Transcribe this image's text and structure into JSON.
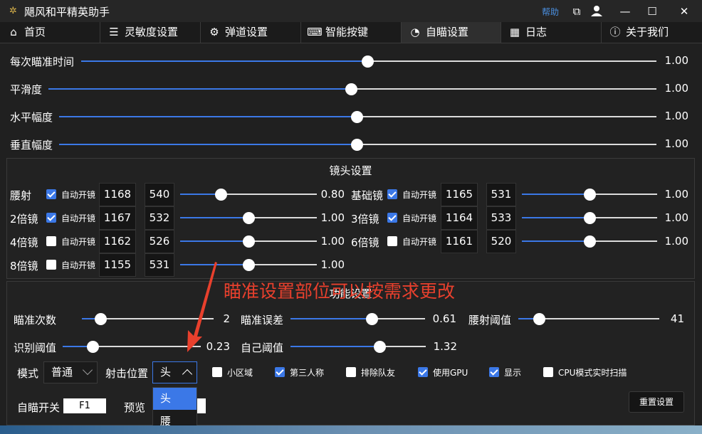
{
  "window": {
    "title": "飓风和平精英助手",
    "help_label": "帮助",
    "controls": [
      "pin-icon",
      "user-icon",
      "minimize-icon",
      "maximize-icon",
      "close-icon"
    ]
  },
  "tabs": [
    {
      "label": "首页",
      "icon": "home-icon"
    },
    {
      "label": "灵敏度设置",
      "icon": "sliders-icon"
    },
    {
      "label": "弹道设置",
      "icon": "gears-icon"
    },
    {
      "label": "智能按键",
      "icon": "keyboard-icon"
    },
    {
      "label": "自瞄设置",
      "icon": "ai-icon",
      "active": true
    },
    {
      "label": "日志",
      "icon": "calendar-icon"
    },
    {
      "label": "关于我们",
      "icon": "info-icon"
    }
  ],
  "top_sliders": [
    {
      "label": "每次瞄准时间",
      "value": "1.00",
      "position": 0.5
    },
    {
      "label": "平滑度",
      "value": "1.00",
      "position": 0.5
    },
    {
      "label": "水平幅度",
      "value": "1.00",
      "position": 0.5
    },
    {
      "label": "垂直幅度",
      "value": "1.00",
      "position": 0.5
    }
  ],
  "lens": {
    "title": "镜头设置",
    "auto_label": "自动开镜",
    "rows": [
      {
        "name": "腰射",
        "checked": true,
        "a": "1168",
        "b": "540",
        "value": "0.80",
        "position": 0.4
      },
      {
        "name": "基础镜",
        "checked": true,
        "a": "1165",
        "b": "531",
        "value": "1.00",
        "position": 0.5
      },
      {
        "name": "2倍镜",
        "checked": true,
        "a": "1167",
        "b": "532",
        "value": "1.00",
        "position": 0.5
      },
      {
        "name": "3倍镜",
        "checked": true,
        "a": "1164",
        "b": "533",
        "value": "1.00",
        "position": 0.5
      },
      {
        "name": "4倍镜",
        "checked": false,
        "a": "1162",
        "b": "526",
        "value": "1.00",
        "position": 0.5
      },
      {
        "name": "6倍镜",
        "checked": false,
        "a": "1161",
        "b": "520",
        "value": "1.00",
        "position": 0.5
      },
      {
        "name": "8倍镜",
        "checked": false,
        "a": "1155",
        "b": "531",
        "value": "1.00",
        "position": 0.5
      }
    ]
  },
  "func": {
    "title": "功能设置",
    "sliders": [
      {
        "label": "瞄准次数",
        "value": "2",
        "position": 0.17
      },
      {
        "label": "瞄准误差",
        "value": "0.61",
        "position": 0.61
      },
      {
        "label": "腰射阈值",
        "value": "41",
        "position": 0.21
      },
      {
        "label": "识别阈值",
        "value": "0.23",
        "position": 0.23
      },
      {
        "label": "自己阈值",
        "value": "1.32",
        "position": 0.66
      }
    ],
    "mode_label": "模式",
    "mode_value": "普通",
    "target_label": "射击位置",
    "target_value": "头",
    "target_options": [
      "头",
      "腰"
    ],
    "checks": [
      {
        "label": "小区域",
        "checked": false
      },
      {
        "label": "第三人称",
        "checked": true
      },
      {
        "label": "排除队友",
        "checked": false
      },
      {
        "label": "使用GPU",
        "checked": true
      },
      {
        "label": "显示",
        "checked": true
      },
      {
        "label": "CPU模式实时扫描",
        "checked": false
      }
    ],
    "hotkey_label": "自瞄开关",
    "hotkey_value": "F1",
    "preview_label": "预览",
    "reset_label": "重置设置"
  },
  "annotation": "瞄准设置部位可以按需求更改",
  "colors": {
    "accent": "#3b78e7",
    "annotation": "#e8402d"
  }
}
